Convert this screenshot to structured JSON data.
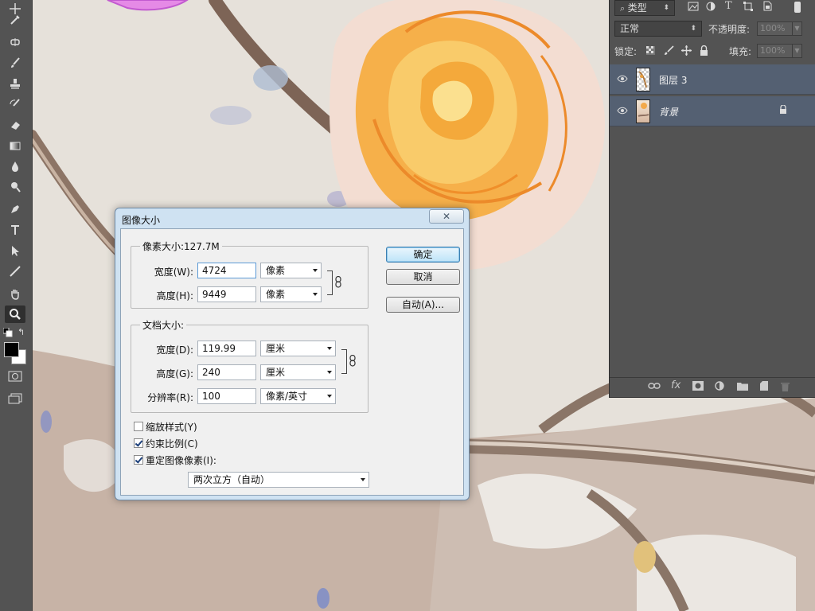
{
  "dialog": {
    "title": "图像大小",
    "close_glyph": "✕",
    "pixel_dimensions": {
      "legend": "像素大小:127.7M",
      "width": {
        "label": "宽度(W):",
        "value": "4724",
        "unit": "像素"
      },
      "height": {
        "label": "高度(H):",
        "value": "9449",
        "unit": "像素"
      }
    },
    "document_size": {
      "legend": "文档大小:",
      "width": {
        "label": "宽度(D):",
        "value": "119.99",
        "unit": "厘米"
      },
      "height": {
        "label": "高度(G):",
        "value": "240",
        "unit": "厘米"
      },
      "resolution": {
        "label": "分辨率(R):",
        "value": "100",
        "unit": "像素/英寸"
      }
    },
    "buttons": {
      "ok": "确定",
      "cancel": "取消",
      "auto": "自动(A)..."
    },
    "options": {
      "scale_styles": {
        "label": "缩放样式(Y)",
        "checked": false
      },
      "constrain": {
        "label": "约束比例(C)",
        "checked": true
      },
      "resample": {
        "label": "重定图像像素(I):",
        "checked": true
      }
    },
    "resample_method": "两次立方（自动）"
  },
  "layers_panel": {
    "filter_kind": "类型",
    "blend_mode": "正常",
    "opacity_label": "不透明度:",
    "opacity_value": "100%",
    "lock_label": "锁定:",
    "fill_label": "填充:",
    "fill_value": "100%",
    "layers": [
      {
        "name": "图层 3"
      },
      {
        "name": "背景"
      }
    ]
  },
  "tools": [
    "move-tool",
    "eyedropper-tool",
    "spot-healing-tool",
    "brush-tool",
    "clone-stamp-tool",
    "history-brush-tool",
    "eraser-tool",
    "gradient-tool",
    "blur-tool",
    "dodge-tool",
    "pen-tool",
    "type-tool",
    "path-selection-tool",
    "line-tool",
    "hand-tool",
    "zoom-tool"
  ],
  "colors": {
    "foreground": "#000000",
    "background": "#ffffff",
    "panel": "#535353",
    "selected_layer": "#546072",
    "dialog_frame": "#cfe2f2"
  }
}
